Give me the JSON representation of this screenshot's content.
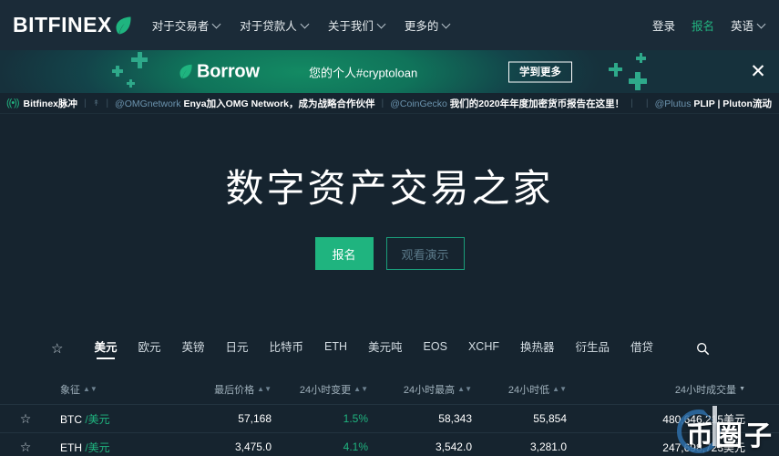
{
  "header": {
    "logo_text": "BITFINEX",
    "logo_icon": "leaf-icon",
    "nav_items": [
      {
        "label": "对于交易者",
        "icon": "chevron-down-icon"
      },
      {
        "label": "对于贷款人",
        "icon": "chevron-down-icon"
      },
      {
        "label": "关于我们",
        "icon": "chevron-down-icon"
      },
      {
        "label": "更多的",
        "icon": "chevron-down-icon"
      }
    ],
    "login_label": "登录",
    "signup_label": "报名",
    "language_label": "英语",
    "language_icon": "chevron-down-icon"
  },
  "promo": {
    "brand_icon": "leaf-icon",
    "brand_label": "Borrow",
    "tagline": "您的个人#cryptoloan",
    "button_label": "学到更多",
    "close_icon": "close-icon"
  },
  "ticker": {
    "pulse_icon": "broadcast-icon",
    "pulse_label": "Bitfinex脉冲",
    "arrow_icon": "up-arrow-icon",
    "items": [
      {
        "handle": "@OMGnetwork",
        "text": "Enya加入OMG Network，成为战略合作伙伴"
      },
      {
        "handle": "@CoinGecko",
        "text": "我们的2020年年度加密货币报告在这里！"
      },
      {
        "handle": "@Plutus",
        "text": "PLIP | Pluton流动"
      }
    ]
  },
  "hero": {
    "title": "数字资产交易之家",
    "primary_button": "报名",
    "secondary_button": "观看演示"
  },
  "market": {
    "favorites_icon": "star-icon",
    "search_icon": "search-icon",
    "tabs": [
      {
        "label": "美元",
        "active": true
      },
      {
        "label": "欧元",
        "active": false
      },
      {
        "label": "英镑",
        "active": false
      },
      {
        "label": "日元",
        "active": false
      },
      {
        "label": "比特币",
        "active": false
      },
      {
        "label": "ETH",
        "active": false
      },
      {
        "label": "美元吨",
        "active": false
      },
      {
        "label": "EOS",
        "active": false
      },
      {
        "label": "XCHF",
        "active": false
      },
      {
        "label": "换热器",
        "active": false
      },
      {
        "label": "衍生品",
        "active": false
      },
      {
        "label": "借贷",
        "active": false
      }
    ],
    "columns": [
      {
        "label": "象征",
        "sort": "both"
      },
      {
        "label": "最后价格",
        "sort": "both"
      },
      {
        "label": "24小时变更",
        "sort": "both"
      },
      {
        "label": "24小时最高",
        "sort": "both"
      },
      {
        "label": "24小时低",
        "sort": "both"
      },
      {
        "label": "24小时成交量",
        "sort": "desc"
      }
    ],
    "rows": [
      {
        "star_icon": "star-icon",
        "base": "BTC",
        "quote": "/美元",
        "last_price": "57,168",
        "change_24h": "1.5%",
        "high_24h": "58,343",
        "low_24h": "55,854",
        "volume_24h": "480,646,215美元"
      },
      {
        "star_icon": "star-icon",
        "base": "ETH",
        "quote": "/美元",
        "last_price": "3,475.0",
        "change_24h": "4.1%",
        "high_24h": "3,542.0",
        "low_24h": "3,281.0",
        "volume_24h": "247,698,723美元"
      }
    ]
  },
  "watermark": {
    "text": "币圈子"
  },
  "colors": {
    "accent_green": "#1fb47f",
    "page_background": "#16242f",
    "nav_background": "#1b2b38",
    "banner_green": "#138a63",
    "handle_blue": "#6b93ae"
  }
}
